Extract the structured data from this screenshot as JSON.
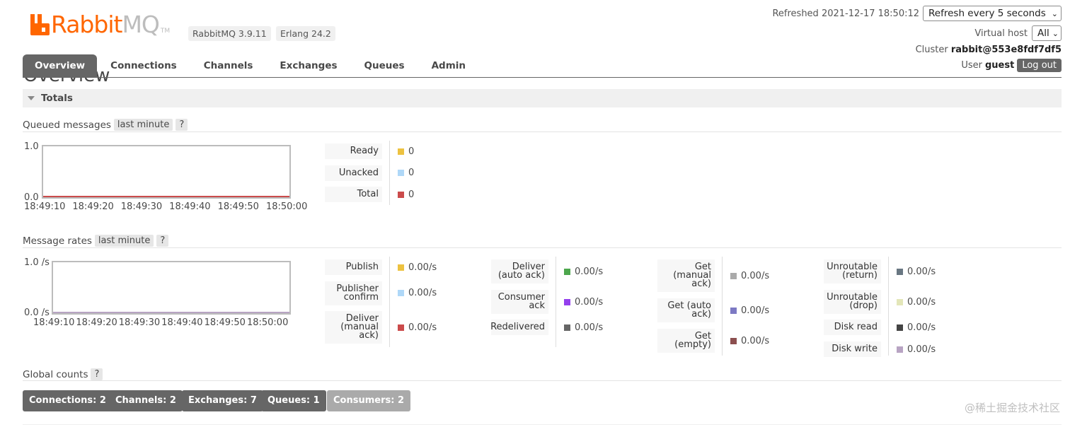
{
  "header": {
    "logo_rabbit": "Rabbit",
    "logo_mq": "MQ",
    "logo_tm": "TM",
    "rabbitmq_version": "RabbitMQ 3.9.11",
    "erlang_version": "Erlang 24.2",
    "refreshed_label": "Refreshed 2021-12-17 18:50:12",
    "refresh_select": "Refresh every 5 seconds",
    "vhost_label": "Virtual host",
    "vhost_select": "All",
    "cluster_label": "Cluster",
    "cluster_name": "rabbit@553e8fdf7df5",
    "user_label": "User",
    "user_name": "guest",
    "logout": "Log out",
    "colors": {
      "brand": "#ff6600",
      "tab_active": "#666666"
    }
  },
  "tabs": [
    {
      "label": "Overview",
      "active": true
    },
    {
      "label": "Connections"
    },
    {
      "label": "Channels"
    },
    {
      "label": "Exchanges"
    },
    {
      "label": "Queues"
    },
    {
      "label": "Admin"
    }
  ],
  "page_title": "Overview",
  "totals_label": "Totals",
  "queued": {
    "title": "Queued messages",
    "range": "last minute",
    "help": "?",
    "y_max": "1.0",
    "y_min": "0.0",
    "x_ticks": [
      "18:49:10",
      "18:49:20",
      "18:49:30",
      "18:49:40",
      "18:49:50",
      "18:50:00"
    ],
    "legend": [
      {
        "label": "Ready",
        "value": "0",
        "color": "#edc240"
      },
      {
        "label": "Unacked",
        "value": "0",
        "color": "#afd8f8"
      },
      {
        "label": "Total",
        "value": "0",
        "color": "#cb4b4b"
      }
    ]
  },
  "rates": {
    "title": "Message rates",
    "range": "last minute",
    "help": "?",
    "y_max": "1.0 /s",
    "y_min": "0.0 /s",
    "x_ticks": [
      "18:49:10",
      "18:49:20",
      "18:49:30",
      "18:49:40",
      "18:49:50",
      "18:50:00"
    ],
    "col1": [
      {
        "label": "Publish",
        "value": "0.00/s",
        "color": "#edc240"
      },
      {
        "label": "Publisher confirm",
        "value": "0.00/s",
        "color": "#afd8f8"
      },
      {
        "label": "Deliver (manual ack)",
        "value": "0.00/s",
        "color": "#cb4b4b"
      }
    ],
    "col2": [
      {
        "label": "Deliver (auto ack)",
        "value": "0.00/s",
        "color": "#4da74d"
      },
      {
        "label": "Consumer ack",
        "value": "0.00/s",
        "color": "#9440ed"
      },
      {
        "label": "Redelivered",
        "value": "0.00/s",
        "color": "#666666"
      }
    ],
    "col3": [
      {
        "label": "Get (manual ack)",
        "value": "0.00/s",
        "color": "#aaaaaa"
      },
      {
        "label": "Get (auto ack)",
        "value": "0.00/s",
        "color": "#7c79c3"
      },
      {
        "label": "Get (empty)",
        "value": "0.00/s",
        "color": "#8c4f4f"
      }
    ],
    "col4": [
      {
        "label": "Unroutable (return)",
        "value": "0.00/s",
        "color": "#697782"
      },
      {
        "label": "Unroutable (drop)",
        "value": "0.00/s",
        "color": "#e3e6b9"
      },
      {
        "label": "Disk read",
        "value": "0.00/s",
        "color": "#444444"
      },
      {
        "label": "Disk write",
        "value": "0.00/s",
        "color": "#b8a4c3"
      }
    ]
  },
  "global_counts": {
    "title": "Global counts",
    "help": "?",
    "buttons": [
      {
        "label": "Connections:",
        "count": "2"
      },
      {
        "label": "Channels:",
        "count": "2"
      },
      {
        "label": "Exchanges:",
        "count": "7"
      },
      {
        "label": "Queues:",
        "count": "1"
      },
      {
        "label": "Consumers:",
        "count": "2"
      }
    ]
  },
  "watermark": "@稀土掘金技术社区"
}
